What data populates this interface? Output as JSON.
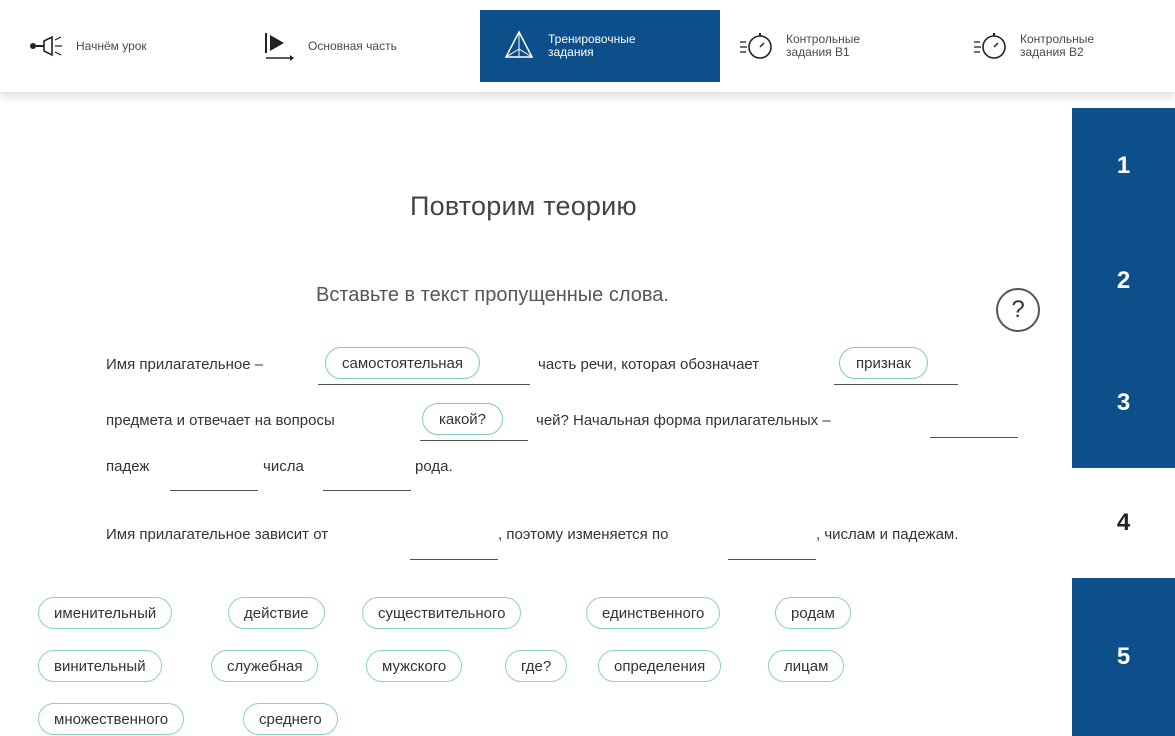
{
  "nav": {
    "items": [
      {
        "label": "Начнём урок",
        "icon": "megaphone-icon"
      },
      {
        "label": "Основная часть",
        "icon": "play-icon"
      },
      {
        "label": "Тренировочные задания",
        "icon": "pyramid-icon"
      },
      {
        "label": "Контрольные задания В1",
        "icon": "stopwatch-icon"
      },
      {
        "label": "Контрольные задания В2",
        "icon": "stopwatch-icon"
      }
    ],
    "active_index": 2
  },
  "side_tabs": [
    "1",
    "2",
    "3",
    "4",
    "5"
  ],
  "main": {
    "title": "Повторим теорию",
    "subtitle": "Вставьте в текст пропущенные слова.",
    "help_icon": "?",
    "text": {
      "l1a": "Имя прилагательное –",
      "l1b": "часть речи, которая обозначает",
      "l2a": "предмета и отвечает на вопросы",
      "l2b": "чей? Начальная форма прилагательных –",
      "l3a": "падеж",
      "l3b": "числа",
      "l3c": "рода.",
      "l4a": "Имя прилагательное зависит от",
      "l4b": ", поэтому изменяется по",
      "l4c": ", числам и падежам."
    },
    "filled": [
      "самостоятельная",
      "признак",
      "какой?"
    ]
  },
  "word_bank": [
    "именительный",
    "действие",
    "существительного",
    "единственного",
    "родам",
    "винительный",
    "служебная",
    "мужского",
    "где?",
    "определения",
    "лицам",
    "множественного",
    "среднего"
  ],
  "colors": {
    "accent": "#0d4f8b",
    "chip_border": "#8bcfcb"
  }
}
